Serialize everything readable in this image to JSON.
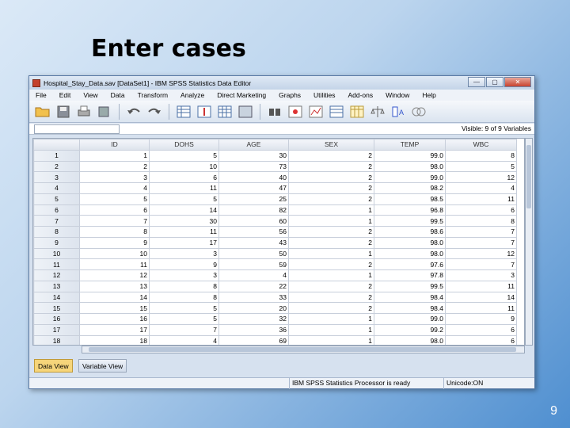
{
  "slide": {
    "title": "Enter cases",
    "page_number": "9"
  },
  "window": {
    "title": "Hospital_Stay_Data.sav [DataSet1] - IBM SPSS Statistics Data Editor",
    "buttons": {
      "minimize": "—",
      "maximize": "▢",
      "close": "✕"
    }
  },
  "menu": [
    "File",
    "Edit",
    "View",
    "Data",
    "Transform",
    "Analyze",
    "Direct Marketing",
    "Graphs",
    "Utilities",
    "Add-ons",
    "Window",
    "Help"
  ],
  "toolbar_icons": [
    "open-folder-icon",
    "save-icon",
    "print-icon",
    "dialog-recall-icon",
    "undo-icon",
    "redo-icon",
    "goto-case-icon",
    "goto-variable-icon",
    "variables-icon",
    "insert-cases-icon",
    "insert-variable-icon",
    "find-icon",
    "split-file-icon",
    "weight-cases-icon",
    "select-cases-icon",
    "value-labels-icon",
    "use-sets-icon",
    "show-all-icon",
    "spell-icon"
  ],
  "cellbar": {
    "visible": "Visible: 9 of 9 Variables"
  },
  "grid": {
    "columns": [
      "ID",
      "DOHS",
      "AGE",
      "SEX",
      "TEMP",
      "WBC"
    ],
    "rows": [
      [
        "1",
        "1",
        "5",
        "30",
        "2",
        "99.0",
        "8"
      ],
      [
        "2",
        "2",
        "10",
        "73",
        "2",
        "98.0",
        "5"
      ],
      [
        "3",
        "3",
        "6",
        "40",
        "2",
        "99.0",
        "12"
      ],
      [
        "4",
        "4",
        "11",
        "47",
        "2",
        "98.2",
        "4"
      ],
      [
        "5",
        "5",
        "5",
        "25",
        "2",
        "98.5",
        "11"
      ],
      [
        "6",
        "6",
        "14",
        "82",
        "1",
        "96.8",
        "6"
      ],
      [
        "7",
        "7",
        "30",
        "60",
        "1",
        "99.5",
        "8"
      ],
      [
        "8",
        "8",
        "11",
        "56",
        "2",
        "98.6",
        "7"
      ],
      [
        "9",
        "9",
        "17",
        "43",
        "2",
        "98.0",
        "7"
      ],
      [
        "10",
        "10",
        "3",
        "50",
        "1",
        "98.0",
        "12"
      ],
      [
        "11",
        "11",
        "9",
        "59",
        "2",
        "97.6",
        "7"
      ],
      [
        "12",
        "12",
        "3",
        "4",
        "1",
        "97.8",
        "3"
      ],
      [
        "13",
        "13",
        "8",
        "22",
        "2",
        "99.5",
        "11"
      ],
      [
        "14",
        "14",
        "8",
        "33",
        "2",
        "98.4",
        "14"
      ],
      [
        "15",
        "15",
        "5",
        "20",
        "2",
        "98.4",
        "11"
      ],
      [
        "16",
        "16",
        "5",
        "32",
        "1",
        "99.0",
        "9"
      ],
      [
        "17",
        "17",
        "7",
        "36",
        "1",
        "99.2",
        "6"
      ],
      [
        "18",
        "18",
        "4",
        "69",
        "1",
        "98.0",
        "6"
      ]
    ]
  },
  "tabs": {
    "data_view": "Data View",
    "variable_view": "Variable View"
  },
  "status": {
    "processor": "IBM SPSS Statistics Processor is ready",
    "unicode": "Unicode:ON"
  }
}
